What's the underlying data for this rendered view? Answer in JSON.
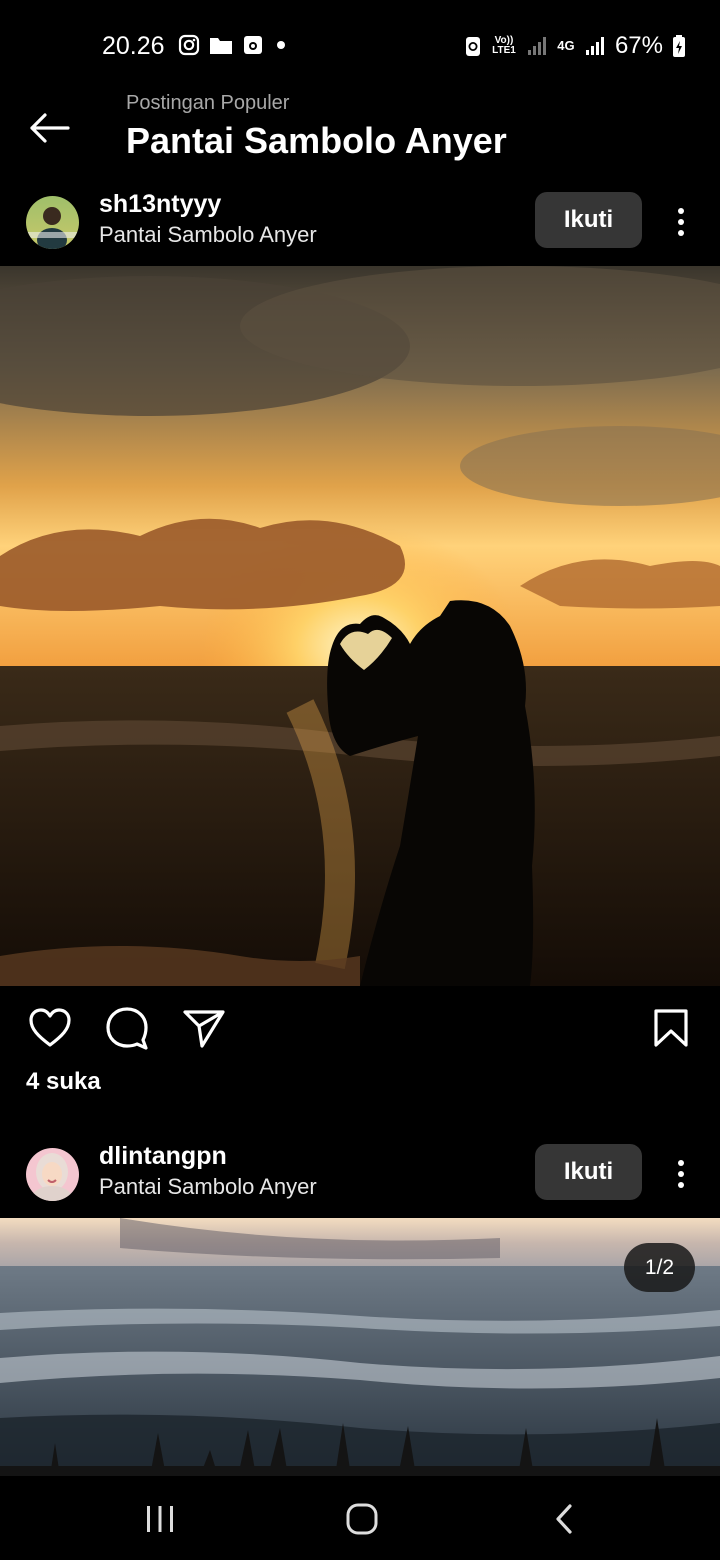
{
  "status_bar": {
    "time": "20.26",
    "lte_label": "Vo)) LTE1",
    "network_label": "4G",
    "battery": "67%",
    "icons": [
      "instagram-icon",
      "folder-icon",
      "screen-record-icon",
      "dot-icon",
      "data-saver-icon",
      "volte-icon",
      "signal-icon",
      "4g-icon",
      "signal-icon",
      "battery-icon"
    ]
  },
  "header": {
    "subtitle": "Postingan Populer",
    "title": "Pantai Sambolo Anyer"
  },
  "posts": [
    {
      "username": "sh13ntyyy",
      "location": "Pantai Sambolo Anyer",
      "follow_label": "Ikuti",
      "likes": "4 suka"
    },
    {
      "username": "dlintangpn",
      "location": "Pantai Sambolo Anyer",
      "follow_label": "Ikuti",
      "page_indicator": "1/2"
    }
  ],
  "colors": {
    "background": "#000000",
    "button": "#363636",
    "secondary_text": "#a8a8a8"
  }
}
